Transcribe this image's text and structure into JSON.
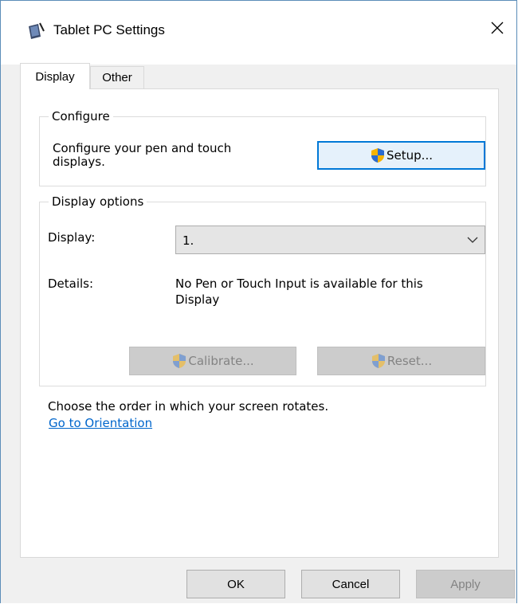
{
  "window": {
    "title": "Tablet PC Settings"
  },
  "tabs": [
    {
      "label": "Display"
    },
    {
      "label": "Other"
    }
  ],
  "configure": {
    "legend": "Configure",
    "description_line1": "Configure your pen and touch",
    "description_line2": "displays.",
    "setup_label": "Setup..."
  },
  "display_options": {
    "legend": "Display options",
    "display_label": "Display:",
    "display_value": "1.",
    "details_label": "Details:",
    "details_line1": "No Pen or Touch Input is available for this",
    "details_line2": "Display",
    "calibrate_label": "Calibrate...",
    "reset_label": "Reset..."
  },
  "orientation": {
    "text": "Choose the order in which your screen rotates.",
    "link": "Go to Orientation"
  },
  "footer": {
    "ok": "OK",
    "cancel": "Cancel",
    "apply": "Apply"
  },
  "colors": {
    "accent": "#0078d7",
    "link": "#0066cc",
    "disabled_text": "#838383"
  },
  "icons": {
    "app": "tablet-pc-icon",
    "close": "close-icon",
    "shield": "uac-shield-icon",
    "dropdown": "chevron-down-icon"
  }
}
